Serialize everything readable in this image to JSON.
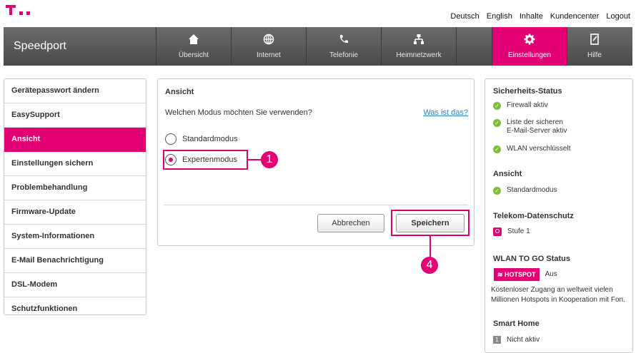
{
  "brand_logo": "T · ·",
  "top_links": [
    "Deutsch",
    "English",
    "Inhalte",
    "Kundencenter",
    "Logout"
  ],
  "nav": {
    "brand": "Speedport",
    "items": [
      {
        "label": "Übersicht",
        "icon": "home-icon"
      },
      {
        "label": "Internet",
        "icon": "globe-icon"
      },
      {
        "label": "Telefonie",
        "icon": "phone-icon"
      },
      {
        "label": "Heimnetzwerk",
        "icon": "network-icon"
      },
      {
        "label": "",
        "icon": ""
      },
      {
        "label": "Einstellungen",
        "icon": "gear-icon"
      },
      {
        "label": "Hilfe",
        "icon": "help-book-icon"
      }
    ],
    "active_color": "#e20074"
  },
  "sidebar": {
    "items": [
      "Gerätepasswort ändern",
      "EasySupport",
      "Ansicht",
      "Einstellungen sichern",
      "Problembehandlung",
      "Firmware-Update",
      "System-Informationen",
      "E-Mail Benachrichtigung",
      "DSL-Modem",
      "Schutzfunktionen"
    ],
    "active_index": 2
  },
  "main": {
    "title": "Ansicht",
    "question": "Welchen Modus möchten Sie verwenden?",
    "help_link": "Was ist das?",
    "options": [
      {
        "label": "Standardmodus",
        "checked": false
      },
      {
        "label": "Expertenmodus",
        "checked": true
      }
    ],
    "cancel_label": "Abbrechen",
    "save_label": "Speichern",
    "callout_1": "1",
    "callout_4": "4"
  },
  "status": {
    "security_title": "Sicherheits-Status",
    "security_items": [
      "Firewall aktiv",
      "Liste der sicheren",
      "E-Mail-Server aktiv",
      "WLAN verschlüsselt"
    ],
    "view_title": "Ansicht",
    "view_value": "Standardmodus",
    "privacy_title": "Telekom-Datenschutz",
    "privacy_value": "Stufe 1",
    "wlan_title": "WLAN TO GO Status",
    "hotspot_badge": "HOTSPOT",
    "hotspot_state": "Aus",
    "wlan_desc_1": "Kostenloser Zugang an weltweit vielen",
    "wlan_desc_2": "Millionen Hotspots in Kooperation mit Fon.",
    "smarthome_title": "Smart Home",
    "smarthome_value": "Nicht aktiv"
  },
  "colors": {
    "magenta": "#e20074",
    "ok_green": "#7cbd3b",
    "link_blue": "#2a7fc1"
  }
}
